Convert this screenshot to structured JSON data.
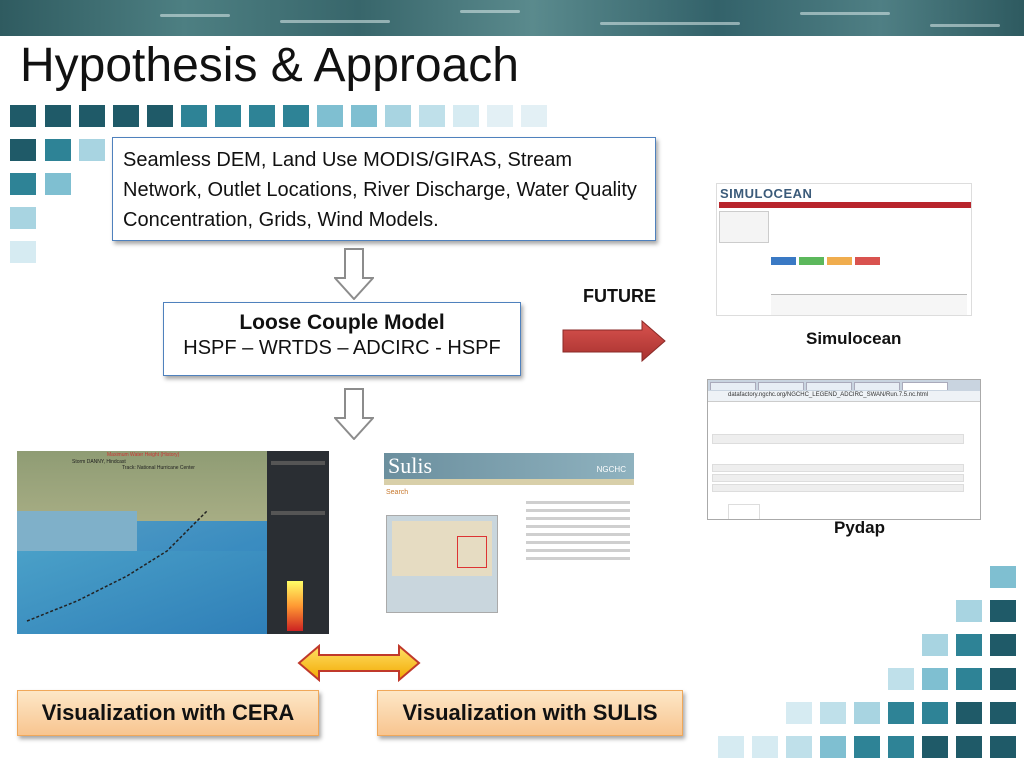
{
  "slide": {
    "title": "Hypothesis & Approach",
    "data_sources": "Seamless DEM, Land Use MODIS/GIRAS, Stream Network, Outlet Locations, River Discharge, Water Quality Concentration, Grids, Wind Models.",
    "model": {
      "title": "Loose Couple Model",
      "chain": "HSPF – WRTDS – ADCIRC - HSPF"
    },
    "future_label": "FUTURE",
    "simulocean_caption": "Simulocean",
    "pydap_caption": "Pydap",
    "cera_button": "Visualization with CERA",
    "sulis_button": "Visualization with SULIS"
  },
  "screenshots": {
    "simulocean": {
      "logo": "SIMULOCEAN"
    },
    "pydap": {
      "url": "datafactory.ngchc.org/NGCHC_LEGEND_ADCIRC_SWAN/Run.7.5.nc.html"
    },
    "cera": {
      "title": "Maximum Water Height (History)",
      "storm": "Storm DANNY, Hindcast",
      "track": "Track: National Hurricane Center"
    },
    "sulis": {
      "name": "Sulis",
      "org": "NGCHC",
      "search_label": "Search"
    }
  },
  "colors": {
    "accent_blue_border": "#4f81bd",
    "arrow_red": "#c0504d",
    "button_fill": "#f8c590",
    "square_dark": "#1f5a68",
    "square_light": "#bfe0ea"
  }
}
